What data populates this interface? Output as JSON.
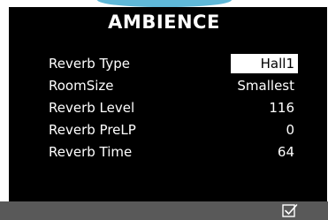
{
  "header": {
    "title": "AMBIENCE"
  },
  "params": [
    {
      "label": "Reverb Type",
      "value": "Hall1"
    },
    {
      "label": "RoomSize",
      "value": "Smallest"
    },
    {
      "label": "Reverb Level",
      "value": "116"
    },
    {
      "label": "Reverb PreLP",
      "value": "0"
    },
    {
      "label": "Reverb Time",
      "value": "64"
    }
  ],
  "footer": {
    "confirm_icon": "checkbox-check-icon"
  },
  "colors": {
    "background": "#000000",
    "accent": "#5fb8d8",
    "footer": "#595959",
    "text": "#ffffff",
    "selection": "#ffffff"
  }
}
